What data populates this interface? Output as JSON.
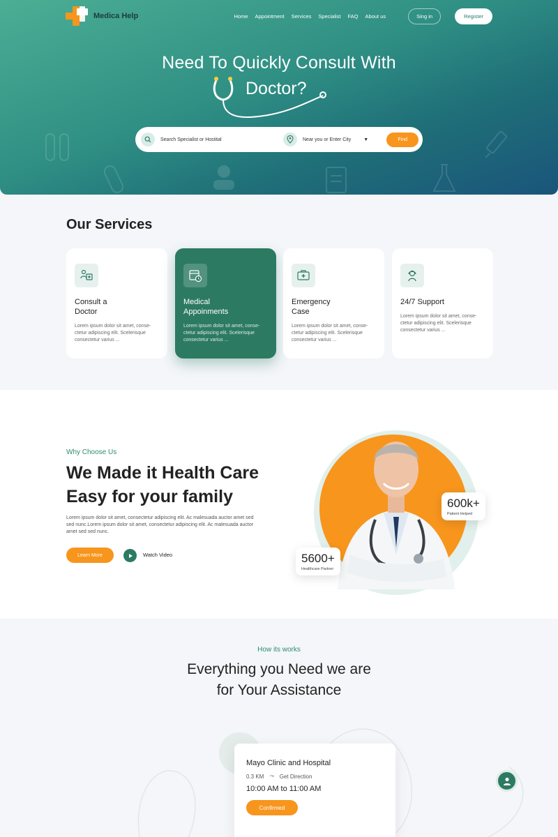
{
  "brand": {
    "name": "Medica Help",
    "accent": "#2d7a63",
    "orange": "#f7951d"
  },
  "nav": {
    "items": [
      "Home",
      "Appointment",
      "Services",
      "Specialist",
      "FAQ",
      "About us"
    ],
    "signin": "Sing in",
    "register": "Register"
  },
  "hero": {
    "title_line1": "Need To Quickly Consult With",
    "title_line2": "Doctor?",
    "search_placeholder": "Search Specialist or Hostital",
    "city_placeholder": "Near you or Enter City",
    "find": "Find"
  },
  "services": {
    "title": "Our Services",
    "items": [
      {
        "title": "Consult a Doctor",
        "desc": "Lorem ipsum dolor sit amet, conse-ctetur adipiscing elit. Scelerisque consectetur varius ..."
      },
      {
        "title": "Medical Appoinments",
        "desc": "Lorem ipsum dolor sit amet, conse-ctetur adipiscing elit. Scelerisque consectetur varius ..."
      },
      {
        "title": "Emergency Case",
        "desc": "Lorem ipsum dolor sit amet, conse-ctetur adipiscing elit. Scelerisque consectetur varius ..."
      },
      {
        "title": "24/7 Support",
        "desc": "Lorem ipsum dolor sit amet, conse-ctetur adipiscing elit. Scelerisque consectetur varius ..."
      }
    ]
  },
  "why": {
    "kicker": "Why Choose Us",
    "heading": "We Made it Health Care Easy for your family",
    "text": "Lorem ipsum dolor sit amet, consectetur adipiscing elit. Ac malesuada auctor amet sed sed nunc.Lorem ipsum dolor sit amet, consectetur adipiscing elit. Ac malesuada auctor amet sed sed nunc.",
    "learn_more": "Learn More",
    "watch_video": "Watch Video",
    "stat1": {
      "value": "600k+",
      "label": "Patient Helped"
    },
    "stat2": {
      "value": "5600+",
      "label": "Healthcare Partner"
    }
  },
  "how": {
    "kicker": "How its works",
    "heading_line1": "Everything you Need we are",
    "heading_line2": "for Your Assistance",
    "card": {
      "title": "Mayo Clinic and Hospital",
      "distance": "0.3 KM",
      "direction": "Get Direction",
      "time": "10:00 AM to 11:00 AM",
      "status": "Confirmed"
    }
  }
}
